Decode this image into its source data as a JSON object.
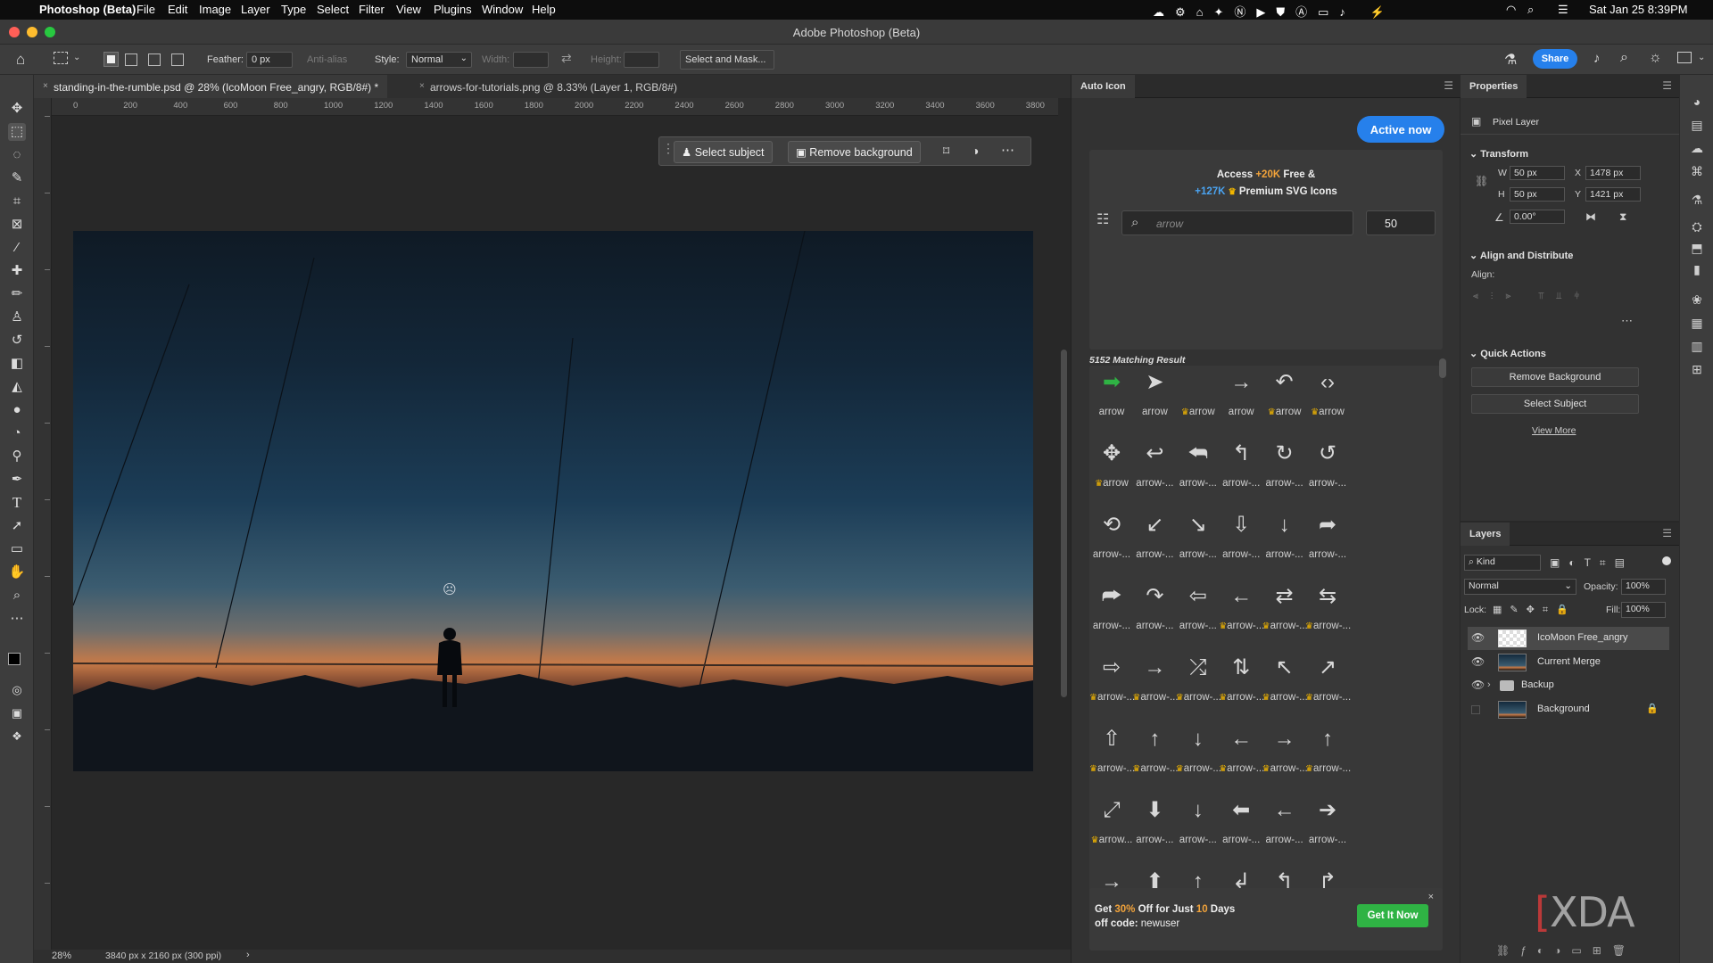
{
  "menubar": {
    "app_name": "Photoshop (Beta)",
    "items": [
      "File",
      "Edit",
      "Image",
      "Layer",
      "Type",
      "Select",
      "Filter",
      "View",
      "Plugins",
      "Window",
      "Help"
    ],
    "datetime": "Sat Jan 25  8:39PM"
  },
  "window": {
    "title": "Adobe Photoshop (Beta)"
  },
  "options_bar": {
    "feather_label": "Feather:",
    "feather_value": "0 px",
    "antialias_label": "Anti-alias",
    "style_label": "Style:",
    "style_value": "Normal",
    "width_label": "Width:",
    "height_label": "Height:",
    "select_mask_label": "Select and Mask...",
    "share_label": "Share"
  },
  "doc_tabs": [
    {
      "label": "standing-in-the-rumble.psd @ 28% (IcoMoon Free_angry, RGB/8#) *"
    },
    {
      "label": "arrows-for-tutorials.png @ 8.33% (Layer 1, RGB/8#)"
    }
  ],
  "ruler": {
    "h_ticks": [
      "0",
      "200",
      "400",
      "600",
      "800",
      "1000",
      "1200",
      "1400",
      "1600",
      "1800",
      "2000",
      "2200",
      "2400",
      "2600",
      "2800",
      "3000",
      "3200",
      "3400",
      "3600",
      "3800"
    ]
  },
  "context_bar": {
    "select_subject": "Select subject",
    "remove_background": "Remove background"
  },
  "status": {
    "zoom": "28%",
    "doc_size": "3840 px x 2160 px (300 ppi)"
  },
  "auto_icon": {
    "tab_title": "Auto Icon",
    "active_now": "Active now",
    "promo_access": "Access",
    "promo_free_count": "+20K",
    "promo_free": "Free &",
    "promo_premium_count": "+127K",
    "promo_premium": "Premium SVG Icons",
    "search_placeholder": "arrow",
    "size_value": "50",
    "result_count": "5152 Matching Result",
    "icons": [
      {
        "glyph": "➡",
        "label": "arrow",
        "premium": false,
        "green": true
      },
      {
        "glyph": "➤",
        "label": "arrow",
        "premium": false
      },
      {
        "glyph": "",
        "label": "arrow",
        "premium": true
      },
      {
        "glyph": "→",
        "label": "arrow",
        "premium": false
      },
      {
        "glyph": "↶",
        "label": "arrow",
        "premium": true
      },
      {
        "glyph": "‹›",
        "label": "arrow",
        "premium": true
      },
      {
        "glyph": "✥",
        "label": "arrow",
        "premium": true
      },
      {
        "glyph": "↩",
        "label": "arrow-...",
        "premium": false
      },
      {
        "glyph": "⮪",
        "label": "arrow-...",
        "premium": false
      },
      {
        "glyph": "↰",
        "label": "arrow-...",
        "premium": false
      },
      {
        "glyph": "↻",
        "label": "arrow-...",
        "premium": false
      },
      {
        "glyph": "↺",
        "label": "arrow-...",
        "premium": false
      },
      {
        "glyph": "⟲",
        "label": "arrow-...",
        "premium": false
      },
      {
        "glyph": "↙",
        "label": "arrow-...",
        "premium": false
      },
      {
        "glyph": "↘",
        "label": "arrow-...",
        "premium": false
      },
      {
        "glyph": "⇩",
        "label": "arrow-...",
        "premium": false
      },
      {
        "glyph": "↓",
        "label": "arrow-...",
        "premium": false
      },
      {
        "glyph": "➦",
        "label": "arrow-...",
        "premium": false
      },
      {
        "glyph": "⮫",
        "label": "arrow-...",
        "premium": false
      },
      {
        "glyph": "↷",
        "label": "arrow-...",
        "premium": false
      },
      {
        "glyph": "⇦",
        "label": "arrow-...",
        "premium": false
      },
      {
        "glyph": "←",
        "label": "arrow-...",
        "premium": true
      },
      {
        "glyph": "⇄",
        "label": "arrow-...",
        "premium": true
      },
      {
        "glyph": "⇆",
        "label": "arrow-...",
        "premium": true
      },
      {
        "glyph": "⇨",
        "label": "arrow-...",
        "premium": true
      },
      {
        "glyph": "→",
        "label": "arrow-...",
        "premium": true
      },
      {
        "glyph": "⤮",
        "label": "arrow-...",
        "premium": true
      },
      {
        "glyph": "⇅",
        "label": "arrow-...",
        "premium": true
      },
      {
        "glyph": "↖",
        "label": "arrow-...",
        "premium": true
      },
      {
        "glyph": "↗",
        "label": "arrow-...",
        "premium": true
      },
      {
        "glyph": "⇧",
        "label": "arrow-...",
        "premium": true
      },
      {
        "glyph": "↑",
        "label": "arrow-...",
        "premium": true
      },
      {
        "glyph": "↓",
        "label": "arrow-...",
        "premium": true
      },
      {
        "glyph": "←",
        "label": "arrow-...",
        "premium": true
      },
      {
        "glyph": "→",
        "label": "arrow-...",
        "premium": true
      },
      {
        "glyph": "↑",
        "label": "arrow-...",
        "premium": true
      },
      {
        "glyph": "⤢",
        "label": "arrow...",
        "premium": true
      },
      {
        "glyph": "⬇",
        "label": "arrow-...",
        "premium": false
      },
      {
        "glyph": "↓",
        "label": "arrow-...",
        "premium": false
      },
      {
        "glyph": "⬅",
        "label": "arrow-...",
        "premium": false
      },
      {
        "glyph": "←",
        "label": "arrow-...",
        "premium": false
      },
      {
        "glyph": "➔",
        "label": "arrow-...",
        "premium": false
      },
      {
        "glyph": "→",
        "label": "arrow-...",
        "premium": false
      },
      {
        "glyph": "⬆",
        "label": "arrow-...",
        "premium": true
      },
      {
        "glyph": "↑",
        "label": "arrow-...",
        "premium": true
      },
      {
        "glyph": "↲",
        "label": "arrow-...",
        "premium": false
      },
      {
        "glyph": "↰",
        "label": "arrow-...",
        "premium": false
      },
      {
        "glyph": "↱",
        "label": "arrow-...",
        "premium": false
      }
    ],
    "ad_prefix": "Get",
    "ad_pct": "30%",
    "ad_mid": "Off for Just",
    "ad_days": "10",
    "ad_suffix": "Days",
    "ad_code_label": "off code:",
    "ad_code": "newuser",
    "ad_button": "Get It Now"
  },
  "properties": {
    "title": "Properties",
    "kind": "Pixel Layer",
    "transform_label": "Transform",
    "w_label": "W",
    "w": "50 px",
    "h_label": "H",
    "h": "50 px",
    "x_label": "X",
    "x": "1478 px",
    "y_label": "Y",
    "y": "1421 px",
    "angle": "0.00°",
    "align_label": "Align and Distribute",
    "align_sub": "Align:",
    "quick_label": "Quick Actions",
    "btn_remove_bg": "Remove Background",
    "btn_select_subject": "Select Subject",
    "view_more": "View More"
  },
  "layers": {
    "title": "Layers",
    "kind_filter": "Kind",
    "blend_mode": "Normal",
    "opacity_label": "Opacity:",
    "opacity": "100%",
    "lock_label": "Lock:",
    "fill_label": "Fill:",
    "fill": "100%",
    "items": [
      {
        "name": "IcoMoon Free_angry"
      },
      {
        "name": "Current Merge"
      },
      {
        "name": "Backup"
      },
      {
        "name": "Background"
      }
    ]
  },
  "watermark": "XDA",
  "colors": {
    "accent": "#2680eb",
    "green": "#2fb344",
    "crown": "#f2b600"
  }
}
